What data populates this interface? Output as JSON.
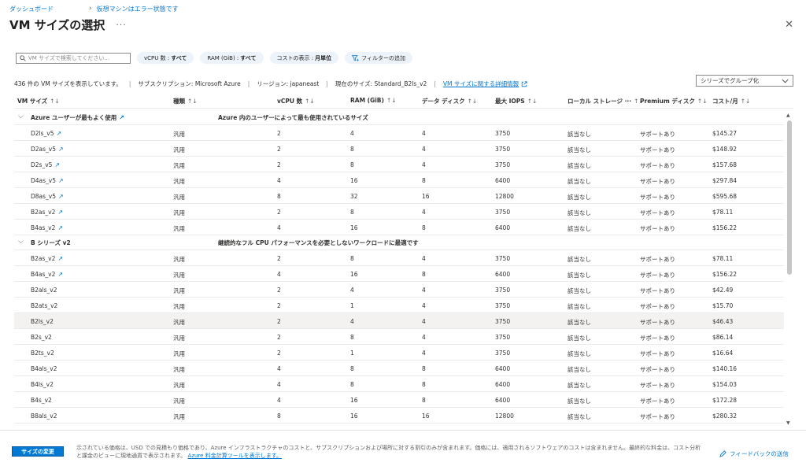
{
  "breadcrumb": [
    {
      "label": "ダッシュボード"
    },
    {
      "label": "仮想マシンはエラー状態です"
    }
  ],
  "header": {
    "title": "VM サイズの選択",
    "more": "···",
    "close": "✕"
  },
  "filters": {
    "search_placeholder": "VM サイズで検索してください...",
    "pills": [
      {
        "label": "vCPU 数 : ",
        "value": "すべて"
      },
      {
        "label": "RAM (GiB) : ",
        "value": "すべて"
      },
      {
        "label": "コストの表示 : ",
        "value": "月単位"
      }
    ],
    "add_filter": "フィルターの追加"
  },
  "summary": {
    "count": "436 件の VM サイズを表示しています。",
    "subscription": "サブスクリプション: Microsoft Azure",
    "region": "リージョン: japaneast",
    "current_size": "現在のサイズ: Standard_B2ls_v2",
    "link": "VM サイズに関する詳細情報",
    "group_by": "シリーズでグループ化"
  },
  "columns": [
    "VM サイズ",
    "種類",
    "vCPU 数",
    "RAM (GiB)",
    "データ ディスク",
    "最大 IOPS",
    "ローカル ストレージ ···",
    "Premium ディスク",
    "コスト/月"
  ],
  "sort_glyph": "↑↓",
  "icons": {
    "trend": "trending-up-icon",
    "chevron": "chevron-down-icon",
    "search": "search-icon",
    "filter": "filter-icon",
    "feedback": "feedback-icon"
  },
  "groups": [
    {
      "name": "Azure ユーザーが最もよく使用",
      "trend": true,
      "description": "Azure 内のユーザーによって最も使用されているサイズ",
      "rows": [
        {
          "name": "D2ls_v5",
          "trend": true,
          "type": "汎用",
          "vcpu": "2",
          "ram": "4",
          "disks": "4",
          "iops": "3750",
          "local": "該当なし",
          "premium": "サポートあり",
          "cost": "$145.27"
        },
        {
          "name": "D2as_v5",
          "trend": true,
          "type": "汎用",
          "vcpu": "2",
          "ram": "8",
          "disks": "4",
          "iops": "3750",
          "local": "該当なし",
          "premium": "サポートあり",
          "cost": "$148.92"
        },
        {
          "name": "D2s_v5",
          "trend": true,
          "type": "汎用",
          "vcpu": "2",
          "ram": "8",
          "disks": "4",
          "iops": "3750",
          "local": "該当なし",
          "premium": "サポートあり",
          "cost": "$157.68"
        },
        {
          "name": "D4as_v5",
          "trend": true,
          "type": "汎用",
          "vcpu": "4",
          "ram": "16",
          "disks": "8",
          "iops": "6400",
          "local": "該当なし",
          "premium": "サポートあり",
          "cost": "$297.84"
        },
        {
          "name": "D8as_v5",
          "trend": true,
          "type": "汎用",
          "vcpu": "8",
          "ram": "32",
          "disks": "16",
          "iops": "12800",
          "local": "該当なし",
          "premium": "サポートあり",
          "cost": "$595.68"
        },
        {
          "name": "B2as_v2",
          "trend": true,
          "type": "汎用",
          "vcpu": "2",
          "ram": "8",
          "disks": "4",
          "iops": "3750",
          "local": "該当なし",
          "premium": "サポートあり",
          "cost": "$78.11"
        },
        {
          "name": "B4as_v2",
          "trend": true,
          "type": "汎用",
          "vcpu": "4",
          "ram": "16",
          "disks": "8",
          "iops": "6400",
          "local": "該当なし",
          "premium": "サポートあり",
          "cost": "$156.22"
        }
      ]
    },
    {
      "name": "B シリーズ v2",
      "trend": false,
      "description": "継続的なフル CPU パフォーマンスを必要としないワークロードに最適です",
      "rows": [
        {
          "name": "B2as_v2",
          "trend": true,
          "type": "汎用",
          "vcpu": "2",
          "ram": "8",
          "disks": "4",
          "iops": "3750",
          "local": "該当なし",
          "premium": "サポートあり",
          "cost": "$78.11"
        },
        {
          "name": "B4as_v2",
          "trend": true,
          "type": "汎用",
          "vcpu": "4",
          "ram": "16",
          "disks": "8",
          "iops": "6400",
          "local": "該当なし",
          "premium": "サポートあり",
          "cost": "$156.22"
        },
        {
          "name": "B2als_v2",
          "trend": false,
          "type": "汎用",
          "vcpu": "2",
          "ram": "4",
          "disks": "4",
          "iops": "3750",
          "local": "該当なし",
          "premium": "サポートあり",
          "cost": "$42.49"
        },
        {
          "name": "B2ats_v2",
          "trend": false,
          "type": "汎用",
          "vcpu": "2",
          "ram": "1",
          "disks": "4",
          "iops": "3750",
          "local": "該当なし",
          "premium": "サポートあり",
          "cost": "$15.70"
        },
        {
          "name": "B2ls_v2",
          "trend": false,
          "selected": true,
          "type": "汎用",
          "vcpu": "2",
          "ram": "4",
          "disks": "4",
          "iops": "3750",
          "local": "該当なし",
          "premium": "サポートあり",
          "cost": "$46.43"
        },
        {
          "name": "B2s_v2",
          "trend": false,
          "type": "汎用",
          "vcpu": "2",
          "ram": "8",
          "disks": "4",
          "iops": "3750",
          "local": "該当なし",
          "premium": "サポートあり",
          "cost": "$86.14"
        },
        {
          "name": "B2ts_v2",
          "trend": false,
          "type": "汎用",
          "vcpu": "2",
          "ram": "1",
          "disks": "4",
          "iops": "3750",
          "local": "該当なし",
          "premium": "サポートあり",
          "cost": "$16.64"
        },
        {
          "name": "B4als_v2",
          "trend": false,
          "type": "汎用",
          "vcpu": "4",
          "ram": "8",
          "disks": "8",
          "iops": "6400",
          "local": "該当なし",
          "premium": "サポートあり",
          "cost": "$140.16"
        },
        {
          "name": "B4ls_v2",
          "trend": false,
          "type": "汎用",
          "vcpu": "4",
          "ram": "8",
          "disks": "8",
          "iops": "6400",
          "local": "該当なし",
          "premium": "サポートあり",
          "cost": "$154.03"
        },
        {
          "name": "B4s_v2",
          "trend": false,
          "type": "汎用",
          "vcpu": "4",
          "ram": "16",
          "disks": "8",
          "iops": "6400",
          "local": "該当なし",
          "premium": "サポートあり",
          "cost": "$172.28"
        },
        {
          "name": "B8als_v2",
          "trend": false,
          "type": "汎用",
          "vcpu": "8",
          "ram": "16",
          "disks": "16",
          "iops": "12800",
          "local": "該当なし",
          "premium": "サポートあり",
          "cost": "$280.32"
        }
      ]
    }
  ],
  "footer": {
    "primary_button": "サイズの変更",
    "note": "示されている価格は、USD での見積もり価格であり、Azure インフラストラクチャのコストと、サブスクリプションおよび場所に対する割引のみが含まれます。価格には、適用されるソフトウェアのコストは含まれません。最終的な料金は、コスト分析と課金のビューに現地通貨で表示されます。",
    "note_link": "Azure 料金計算ツールを表示します。",
    "feedback": "フィードバックの送信"
  },
  "colors": {
    "accent": "#0078d4",
    "selected_row": "#f3f2f1",
    "pill_bg": "#edf3fa"
  }
}
